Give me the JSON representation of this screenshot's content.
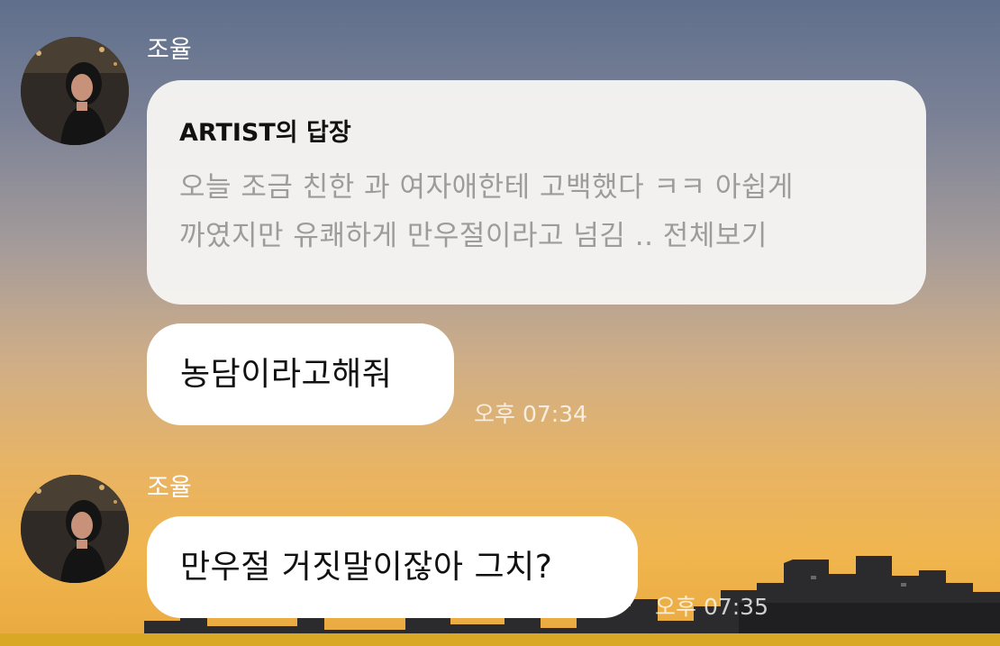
{
  "groups": [
    {
      "sender": "조율",
      "avatar_icon": "profile-photo",
      "reply_card": {
        "title": "ARTIST의 답장",
        "line1": "오늘 조금 친한 과 여자애한테 고백했다 ㅋㅋ 아쉽게",
        "line2": "까였지만 유쾌하게 만우절이라고 넘김 .. 전체보기"
      },
      "message": "농담이라고해줘",
      "time": "오후 07:34"
    },
    {
      "sender": "조율",
      "avatar_icon": "profile-photo",
      "message": "만우절 거짓말이잖아 그치?",
      "time": "오후 07:35"
    }
  ],
  "colors": {
    "bubble": "#ffffff",
    "reply_card": "#f6f5f3",
    "reply_text": "#9c9c9c",
    "timestamp": "#ffffff"
  }
}
